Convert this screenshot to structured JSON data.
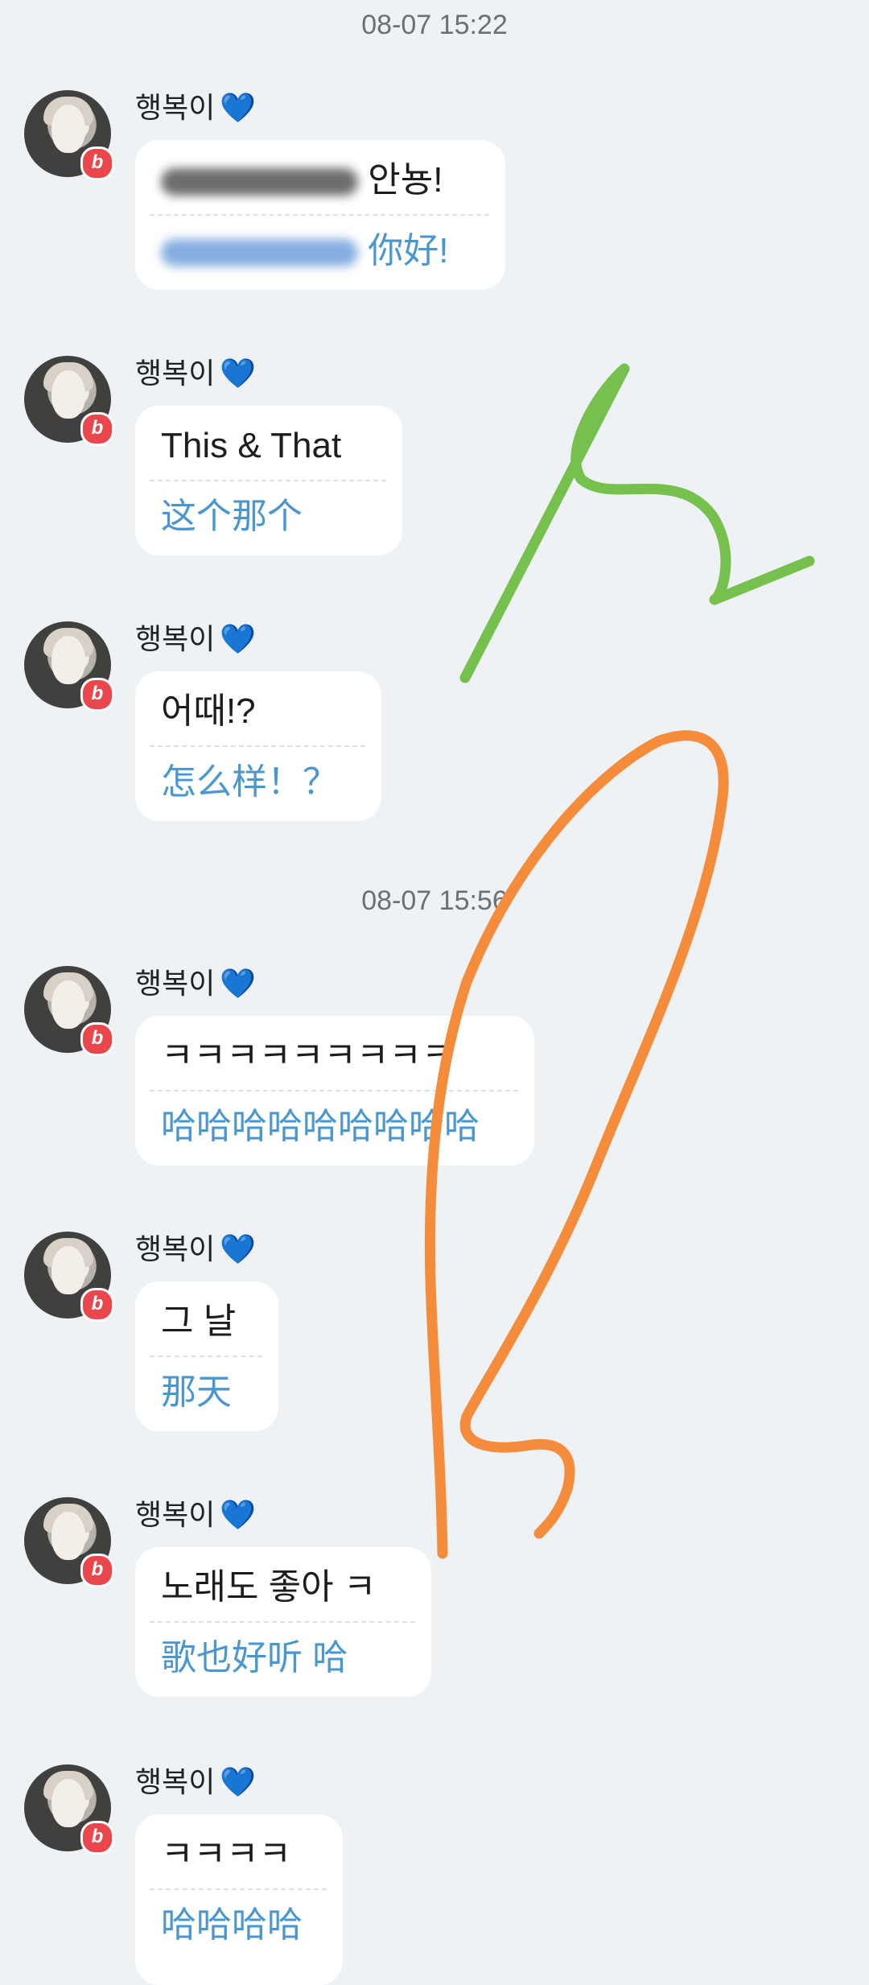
{
  "timestamps": [
    "08-07 15:22",
    "08-07 15:56"
  ],
  "sender": {
    "name": "행복이",
    "name_emoji": "💙",
    "badge": "b"
  },
  "messages": [
    {
      "original": "안뇽!",
      "translation": "你好!",
      "redacted": true
    },
    {
      "original": "This & That",
      "translation": "这个那个"
    },
    {
      "original": "어때!?",
      "translation": "怎么样！？"
    },
    {
      "original": "ㅋㅋㅋㅋㅋㅋㅋㅋㅋ",
      "translation": "哈哈哈哈哈哈哈哈哈"
    },
    {
      "original": "그 날",
      "translation": "那天"
    },
    {
      "original": "노래도 좋아 ㅋ",
      "translation": "歌也好听 哈"
    },
    {
      "original": "ㅋㅋㅋㅋ",
      "translation": "哈哈哈哈"
    }
  ],
  "annotation_colors": {
    "green": "#76c04e",
    "orange": "#f58c3b"
  }
}
